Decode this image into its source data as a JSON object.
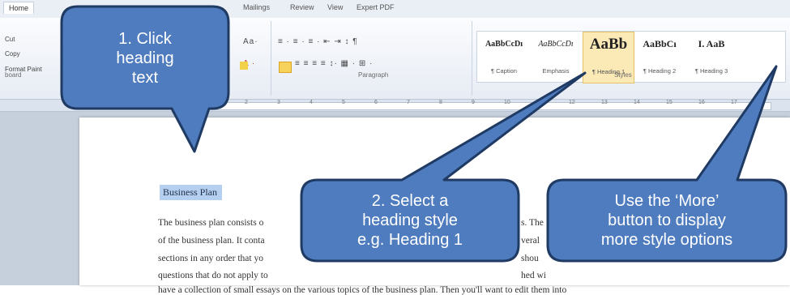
{
  "ribbon": {
    "tabs": [
      "Home",
      "Mailings",
      "Review",
      "View",
      "Expert PDF"
    ],
    "clipboard": {
      "cut": "Cut",
      "copy": "Copy",
      "format_painter": "Format Paint",
      "group_label": "board"
    },
    "paragraph_label": "Paragraph",
    "styles_label": "Styles",
    "style_tiles": [
      {
        "sample": "AaBbCcDı",
        "name": "¶ Caption"
      },
      {
        "sample": "AaBbCcDı",
        "name": "Emphasis"
      },
      {
        "sample": "AaBb",
        "name": "¶ Heading 1"
      },
      {
        "sample": "AaBbCı",
        "name": "¶ Heading 2"
      },
      {
        "sample": "I. AaB",
        "name": "¶ Heading 3"
      }
    ]
  },
  "document": {
    "heading": "Business Plan",
    "lines": [
      "The business plan consists o",
      "s. The",
      "of the business plan. It conta",
      "veral",
      "sections in any order that yo",
      "shou",
      "questions that do not apply to",
      "hed wi",
      "have a collection of small essays on the various topics of the business plan. Then you'll want to edit them into"
    ]
  },
  "callouts": {
    "step1": [
      "1. Click",
      "heading",
      "text"
    ],
    "step2": [
      "2. Select a",
      "heading style",
      "e.g. Heading 1"
    ],
    "step3": [
      "Use the ‘More’",
      "button to display",
      "more style options"
    ]
  },
  "colors": {
    "callout_fill": "#4f7cbf",
    "callout_border": "#1f3a63",
    "highlight": "#b5cff0"
  }
}
